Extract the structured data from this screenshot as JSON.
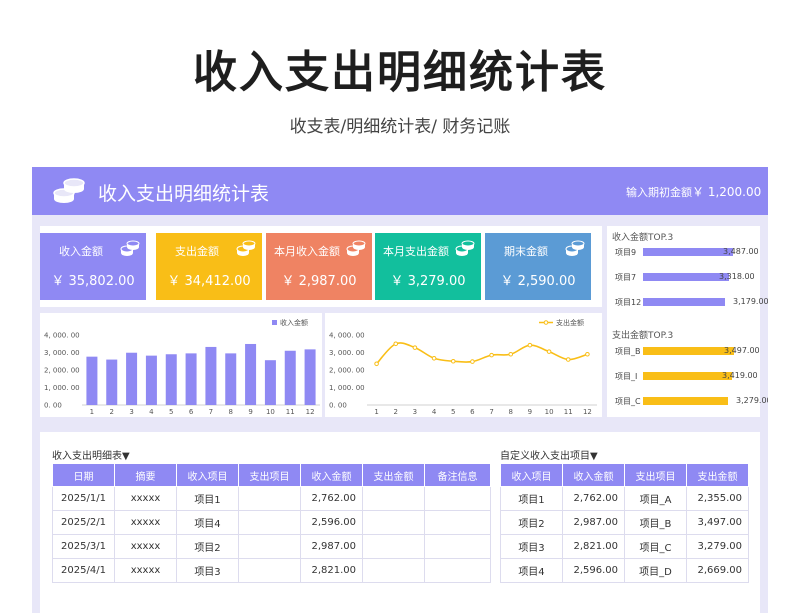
{
  "title": "收入支出明细统计表",
  "subtitle": "收支表/明细统计表/ 财务记账",
  "header": {
    "title": "收入支出明细统计表",
    "opening_label": "输入期初金额",
    "opening_value": "￥ 1,200.00"
  },
  "cards": [
    {
      "label": "收入金额",
      "value": "￥ 35,802.00",
      "color": "#8f89f3"
    },
    {
      "label": "支出金额",
      "value": "￥ 34,412.00",
      "color": "#f9be17"
    },
    {
      "label": "本月收入金额",
      "value": "￥ 2,987.00",
      "color": "#ef8363"
    },
    {
      "label": "本月支出金额",
      "value": "￥ 3,279.00",
      "color": "#12bf9d"
    },
    {
      "label": "期末金额",
      "value": "￥ 2,590.00",
      "color": "#5b9bd5"
    }
  ],
  "income_top": {
    "title": "收入金额TOP.3",
    "color": "#8f89f3",
    "max": 3700,
    "items": [
      {
        "label": "项目9",
        "value": 3487,
        "display": "3,487.00"
      },
      {
        "label": "项目7",
        "value": 3318,
        "display": "3,318.00"
      },
      {
        "label": "项目12",
        "value": 3179,
        "display": "3,179.00"
      }
    ]
  },
  "expense_top": {
    "title": "支出金额TOP.3",
    "color": "#f9be17",
    "max": 3700,
    "items": [
      {
        "label": "项目_B",
        "value": 3497,
        "display": "3,497.00"
      },
      {
        "label": "项目_I",
        "value": 3419,
        "display": "3,419.00"
      },
      {
        "label": "项目_C",
        "value": 3279,
        "display": "3,279.00"
      }
    ]
  },
  "chart_data": [
    {
      "type": "bar",
      "color": "#8f89f3",
      "legend": "收入金额",
      "legend_position": "top-right",
      "categories": [
        "1",
        "2",
        "3",
        "4",
        "5",
        "6",
        "7",
        "8",
        "9",
        "10",
        "11",
        "12"
      ],
      "series": [
        {
          "name": "收入金额",
          "values": [
            2762,
            2596,
            2987,
            2821,
            2900,
            2950,
            3318,
            2950,
            3487,
            2560,
            3100,
            3179
          ]
        }
      ],
      "ylim": [
        0,
        4000
      ],
      "yticks": [
        "4, 000. 00",
        "3, 000. 00",
        "2, 000. 00",
        "1, 000. 00",
        "0. 00"
      ]
    },
    {
      "type": "line",
      "color": "#f9be17",
      "legend": "支出金额",
      "legend_position": "top-right",
      "categories": [
        "1",
        "2",
        "3",
        "4",
        "5",
        "6",
        "7",
        "8",
        "9",
        "10",
        "11",
        "12"
      ],
      "series": [
        {
          "name": "支出金额",
          "values": [
            2355,
            3497,
            3279,
            2669,
            2500,
            2480,
            2850,
            2900,
            3419,
            3050,
            2600,
            2900
          ]
        }
      ],
      "ylim": [
        0,
        4000
      ],
      "yticks": [
        "4, 000. 00",
        "3, 000. 00",
        "2, 000. 00",
        "1, 000. 00",
        "0. 00"
      ]
    }
  ],
  "detail_table": {
    "title": "收入支出明细表▼",
    "headers": [
      "日期",
      "摘要",
      "收入项目",
      "支出项目",
      "收入金额",
      "支出金额",
      "备注信息"
    ],
    "rows": [
      [
        "2025/1/1",
        "xxxxx",
        "项目1",
        "",
        "2,762.00",
        "",
        ""
      ],
      [
        "2025/2/1",
        "xxxxx",
        "项目4",
        "",
        "2,596.00",
        "",
        ""
      ],
      [
        "2025/3/1",
        "xxxxx",
        "项目2",
        "",
        "2,987.00",
        "",
        ""
      ],
      [
        "2025/4/1",
        "xxxxx",
        "项目3",
        "",
        "2,821.00",
        "",
        ""
      ]
    ]
  },
  "custom_table": {
    "title": "自定义收入支出项目▼",
    "headers": [
      "收入项目",
      "收入金额",
      "支出项目",
      "支出金额"
    ],
    "rows": [
      [
        "项目1",
        "2,762.00",
        "项目_A",
        "2,355.00"
      ],
      [
        "项目2",
        "2,987.00",
        "项目_B",
        "3,497.00"
      ],
      [
        "项目3",
        "2,821.00",
        "项目_C",
        "3,279.00"
      ],
      [
        "项目4",
        "2,596.00",
        "项目_D",
        "2,669.00"
      ]
    ]
  }
}
